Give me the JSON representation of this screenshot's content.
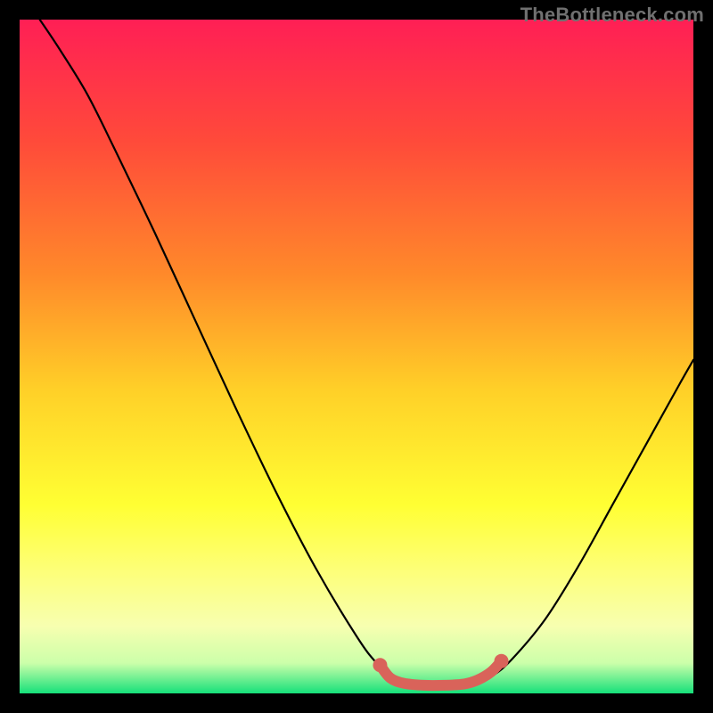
{
  "watermark": "TheBottleneck.com",
  "chart_data": {
    "type": "line",
    "title": "",
    "xlabel": "",
    "ylabel": "",
    "xlim": [
      0,
      100
    ],
    "ylim": [
      0,
      100
    ],
    "gradient_stops": [
      {
        "offset": 0.0,
        "color": "#ff1f55"
      },
      {
        "offset": 0.18,
        "color": "#ff4a3a"
      },
      {
        "offset": 0.38,
        "color": "#ff8a2a"
      },
      {
        "offset": 0.55,
        "color": "#ffd028"
      },
      {
        "offset": 0.72,
        "color": "#ffff33"
      },
      {
        "offset": 0.82,
        "color": "#fdff7a"
      },
      {
        "offset": 0.9,
        "color": "#f7ffb0"
      },
      {
        "offset": 0.955,
        "color": "#ccffaa"
      },
      {
        "offset": 1.0,
        "color": "#16e07a"
      }
    ],
    "series": [
      {
        "name": "bottleneck-curve",
        "type": "line",
        "stroke": "#000000",
        "stroke_width": 2.2,
        "points": [
          {
            "x": 3.0,
            "y": 100.0
          },
          {
            "x": 6.0,
            "y": 95.5
          },
          {
            "x": 10.0,
            "y": 89.0
          },
          {
            "x": 14.0,
            "y": 81.0
          },
          {
            "x": 20.0,
            "y": 68.5
          },
          {
            "x": 26.0,
            "y": 55.5
          },
          {
            "x": 32.0,
            "y": 42.5
          },
          {
            "x": 38.0,
            "y": 30.0
          },
          {
            "x": 44.0,
            "y": 18.5
          },
          {
            "x": 50.0,
            "y": 8.5
          },
          {
            "x": 53.0,
            "y": 4.5
          },
          {
            "x": 56.0,
            "y": 2.0
          },
          {
            "x": 59.0,
            "y": 1.0
          },
          {
            "x": 63.0,
            "y": 1.0
          },
          {
            "x": 67.0,
            "y": 1.2
          },
          {
            "x": 70.0,
            "y": 2.5
          },
          {
            "x": 73.0,
            "y": 5.0
          },
          {
            "x": 78.0,
            "y": 11.0
          },
          {
            "x": 83.0,
            "y": 19.0
          },
          {
            "x": 88.0,
            "y": 28.0
          },
          {
            "x": 93.0,
            "y": 37.0
          },
          {
            "x": 98.0,
            "y": 46.0
          },
          {
            "x": 100.0,
            "y": 49.5
          }
        ]
      },
      {
        "name": "optimal-zone-marker",
        "type": "line",
        "stroke": "#d9635a",
        "stroke_width": 12,
        "cap_radius": 8,
        "points": [
          {
            "x": 53.5,
            "y": 4.2
          },
          {
            "x": 55.0,
            "y": 2.3
          },
          {
            "x": 57.0,
            "y": 1.5
          },
          {
            "x": 60.0,
            "y": 1.2
          },
          {
            "x": 63.0,
            "y": 1.2
          },
          {
            "x": 66.0,
            "y": 1.4
          },
          {
            "x": 68.0,
            "y": 2.0
          },
          {
            "x": 70.0,
            "y": 3.2
          },
          {
            "x": 71.5,
            "y": 4.8
          }
        ]
      }
    ]
  }
}
